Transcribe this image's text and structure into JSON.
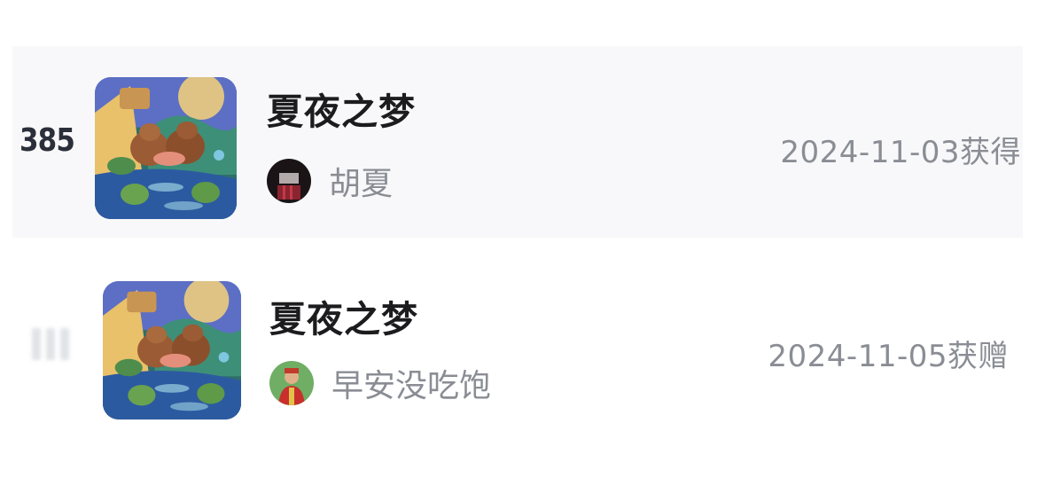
{
  "records": [
    {
      "rank": "385",
      "title": "夏夜之梦",
      "username": "胡夏",
      "date": "2024-11-03获得",
      "cover_icon": "summer-night-dream-cover",
      "avatar_icon": "user-avatar-dark"
    },
    {
      "rank": "",
      "title": "夏夜之梦",
      "username": "早安没吃饱",
      "date": "2024-11-05获赠",
      "cover_icon": "summer-night-dream-cover",
      "avatar_icon": "user-avatar-green"
    }
  ],
  "colors": {
    "title": "#1c1c1e",
    "secondary_text": "#8a8d94",
    "rank": "#2b2f3a",
    "highlight_row": "#f8f8fa"
  }
}
